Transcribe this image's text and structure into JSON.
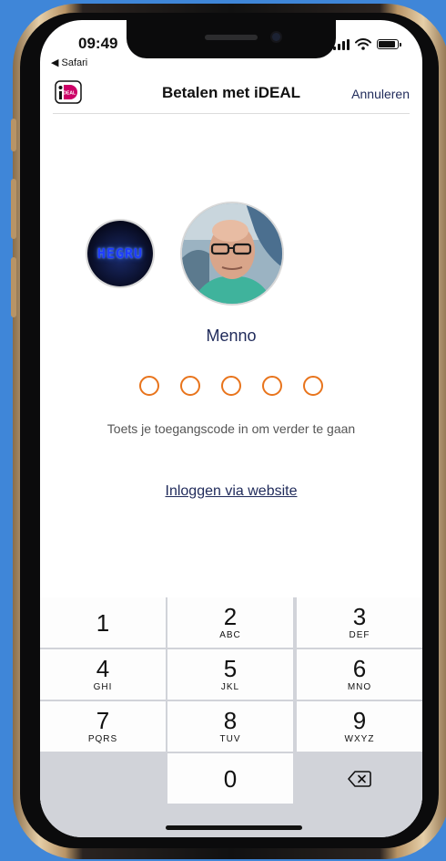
{
  "status": {
    "time": "09:49",
    "back_label": "◀ Safari"
  },
  "navbar": {
    "logo_text": "iDEAL",
    "title": "Betalen met iDEAL",
    "cancel_label": "Annuleren"
  },
  "merchant": {
    "logo_text": "HEGRU"
  },
  "user": {
    "name": "Menno"
  },
  "pin": {
    "length": 5,
    "entered": 0
  },
  "prompt": "Toets je toegangscode in om verder te gaan",
  "web_login_label": "Inloggen via website",
  "keypad": {
    "keys": [
      {
        "digit": "1",
        "letters": ""
      },
      {
        "digit": "2",
        "letters": "ABC"
      },
      {
        "digit": "3",
        "letters": "DEF"
      },
      {
        "digit": "4",
        "letters": "GHI"
      },
      {
        "digit": "5",
        "letters": "JKL"
      },
      {
        "digit": "6",
        "letters": "MNO"
      },
      {
        "digit": "7",
        "letters": "PQRS"
      },
      {
        "digit": "8",
        "letters": "TUV"
      },
      {
        "digit": "9",
        "letters": "WXYZ"
      },
      {
        "digit": "0",
        "letters": ""
      }
    ]
  },
  "colors": {
    "accent": "#e8741c",
    "brand_navy": "#1f2a5a",
    "ideal_pink": "#cc0066",
    "background": "#3f86d8"
  }
}
